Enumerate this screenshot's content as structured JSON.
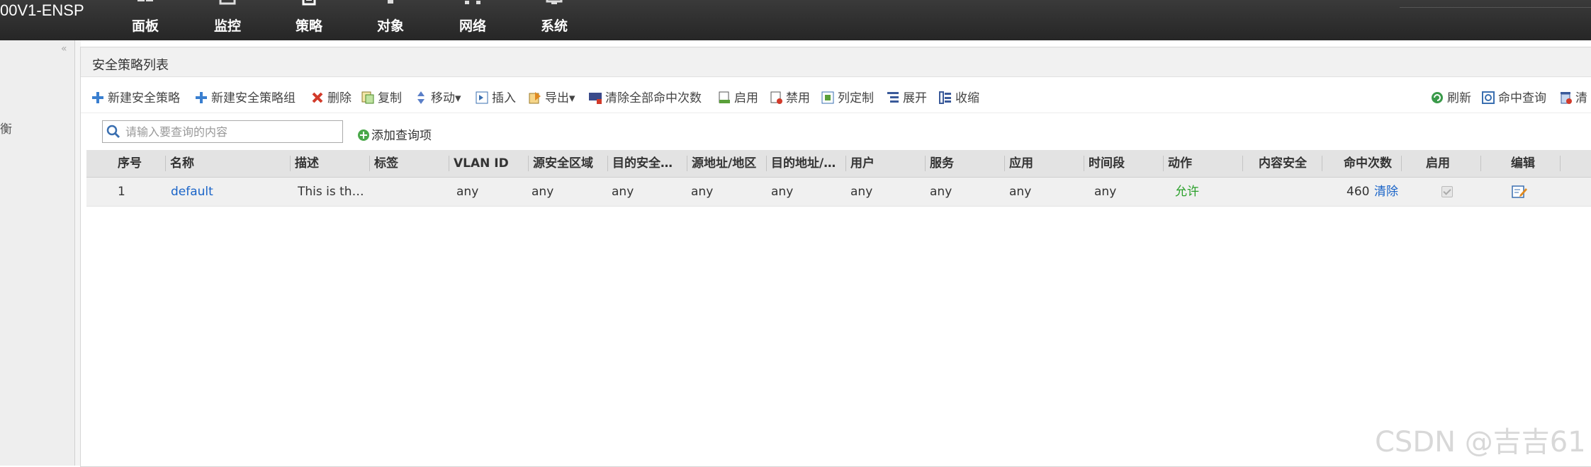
{
  "brand": "00V1-ENSP",
  "nav": [
    {
      "label": "面板",
      "icon": "dashboard-icon"
    },
    {
      "label": "监控",
      "icon": "monitor-icon"
    },
    {
      "label": "策略",
      "icon": "policy-icon"
    },
    {
      "label": "对象",
      "icon": "object-icon"
    },
    {
      "label": "网络",
      "icon": "network-icon"
    },
    {
      "label": "系统",
      "icon": "system-icon"
    }
  ],
  "nav_active": "策略",
  "sidebar": {
    "collapse": "«",
    "item_fragment": "衡"
  },
  "panel": {
    "title": "安全策略列表"
  },
  "toolbar": {
    "new_policy": "新建安全策略",
    "new_group": "新建安全策略组",
    "delete": "删除",
    "copy": "复制",
    "move": "移动▾",
    "insert": "插入",
    "export": "导出▾",
    "clear_hits": "清除全部命中次数",
    "enable": "启用",
    "disable": "禁用",
    "customize_columns": "列定制",
    "expand": "展开",
    "collapse": "收缩",
    "refresh": "刷新",
    "hit_query": "命中查询",
    "clear_partial": "清"
  },
  "search": {
    "placeholder": "请输入要查询的内容",
    "value": "",
    "add_query": "添加查询项"
  },
  "table": {
    "columns": [
      "序号",
      "名称",
      "描述",
      "标签",
      "VLAN ID",
      "源安全区域",
      "目的安全…",
      "源地址/地区",
      "目的地址/…",
      "用户",
      "服务",
      "应用",
      "时间段",
      "动作",
      "内容安全",
      "命中次数",
      "启用",
      "编辑"
    ],
    "rows": [
      {
        "seq": "1",
        "name": "default",
        "description": "This is th…",
        "tag": "",
        "vlan": "any",
        "src_zone": "any",
        "dst_zone": "any",
        "src_addr": "any",
        "dst_addr": "any",
        "user": "any",
        "service": "any",
        "app": "any",
        "schedule": "any",
        "action": "允许",
        "content_security": "",
        "hits": "460",
        "clear": "清除",
        "enabled": true
      }
    ]
  },
  "watermark": "CSDN @吉吉61",
  "colors": {
    "topbar": "#2e2e2e",
    "link": "#1a64c8",
    "allow": "#2aa02a",
    "header_bg": "#e3e3e3"
  }
}
